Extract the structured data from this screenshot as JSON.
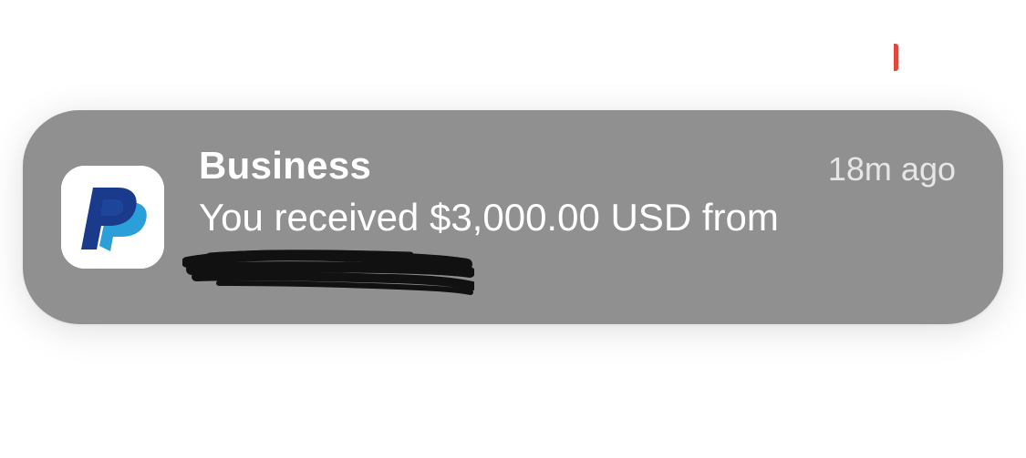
{
  "notification": {
    "app_name": "Business",
    "timestamp": "18m ago",
    "message": "You received $3,000.00 USD from",
    "app_icon": "paypal-icon",
    "colors": {
      "banner_bg": "#909090",
      "icon_dark_blue": "#1a3a8c",
      "icon_light_blue": "#2a9fd9"
    }
  }
}
